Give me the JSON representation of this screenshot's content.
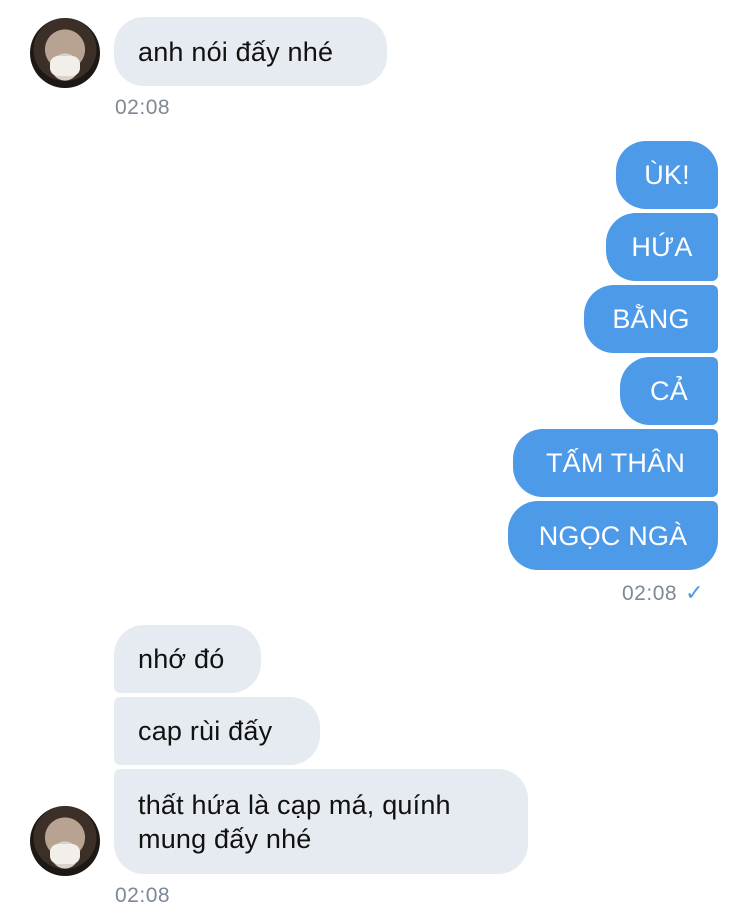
{
  "messages": {
    "group1": {
      "text": "anh nói đấy nhé",
      "time": "02:08"
    },
    "outgoing": {
      "items": [
        "ÙK!",
        "HỨA",
        "BẰNG",
        "CẢ",
        "TẤM THÂN",
        "NGỌC NGÀ"
      ],
      "time": "02:08",
      "status_icon": "check-icon"
    },
    "group2": {
      "items": [
        "nhớ đó",
        "cap rùi đấy",
        "thất hứa là cạp má, quính mung đấy nhé"
      ],
      "time": "02:08"
    }
  },
  "colors": {
    "outgoing": "#4d9ae8",
    "incoming": "#e6eaf1"
  }
}
